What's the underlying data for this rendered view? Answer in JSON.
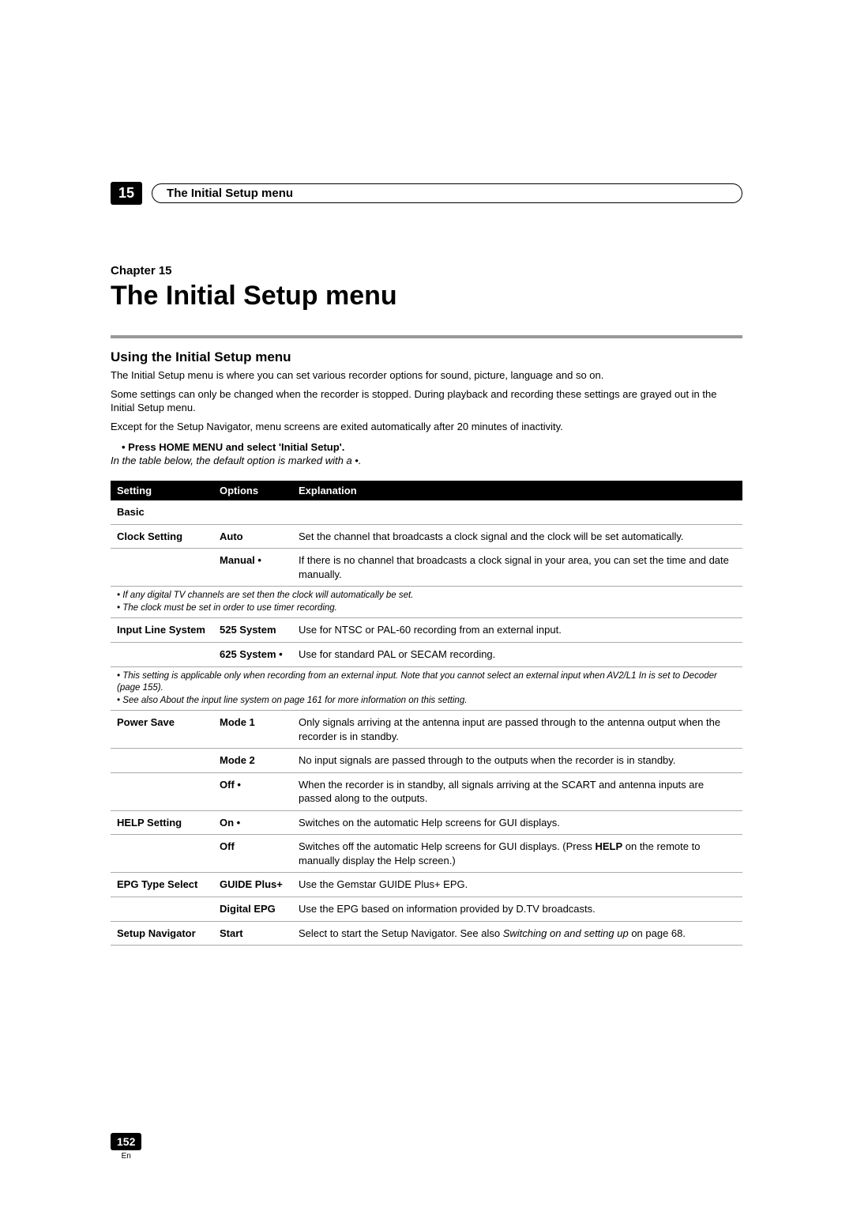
{
  "header": {
    "chapter_num": "15",
    "pill_title": "The Initial Setup menu"
  },
  "chapter": {
    "label": "Chapter 15",
    "title": "The Initial Setup menu"
  },
  "section": {
    "title": "Using the Initial Setup menu",
    "para1": "The Initial Setup menu is where you can set various recorder options for sound, picture, language and so on.",
    "para2": "Some settings can only be changed when the recorder is stopped. During playback and recording these settings are grayed out in the Initial Setup menu.",
    "para3": "Except for the Setup Navigator, menu screens are exited automatically after 20 minutes of inactivity.",
    "bullet": "•   Press HOME MENU and select 'Initial Setup'.",
    "italic_note": "In the table below, the default option is marked with a •."
  },
  "table": {
    "head": {
      "c1": "Setting",
      "c2": "Options",
      "c3": "Explanation"
    },
    "basic_label": "Basic",
    "rows": {
      "clock_auto": {
        "setting": "Clock Setting",
        "option": "Auto",
        "expl": "Set the channel that broadcasts a clock signal and the clock will be set automatically."
      },
      "clock_manual": {
        "option": "Manual •",
        "expl": "If there is no channel that broadcasts a clock signal in your area, you can set the time and date manually."
      },
      "note1a": "• If any digital TV channels are set then the clock will automatically be set.",
      "note1b": "• The clock must be set in order to use timer recording.",
      "ils_525": {
        "setting": "Input Line System",
        "option": "525 System",
        "expl": "Use for NTSC or PAL-60 recording from an external input."
      },
      "ils_625": {
        "option": "625 System •",
        "expl": "Use for standard PAL or SECAM recording."
      },
      "note2a": "• This setting is applicable only when recording from an external input. Note that you cannot select an external input when AV2/L1 In is set to Decoder (page 155).",
      "note2b": "• See also About the input line system on page 161 for more information on this setting.",
      "ps_mode1": {
        "setting": "Power Save",
        "option": "Mode 1",
        "expl": "Only signals arriving at the antenna input are passed through to the antenna output when the recorder is in standby."
      },
      "ps_mode2": {
        "option": "Mode 2",
        "expl": "No input signals are passed through to the outputs when the recorder is in standby."
      },
      "ps_off": {
        "option": "Off •",
        "expl": "When the recorder is in standby, all signals arriving at the SCART and antenna inputs are passed along to the outputs."
      },
      "help_on": {
        "setting": "HELP Setting",
        "option": "On •",
        "expl": "Switches on the automatic Help screens for GUI displays."
      },
      "help_off_pre": "Switches off the automatic Help screens for GUI displays. (Press ",
      "help_off_bold": "HELP",
      "help_off_post": " on the remote to manually display the Help screen.)",
      "help_off_option": "Off",
      "epg_gp": {
        "setting": "EPG Type Select",
        "option": "GUIDE Plus+",
        "expl": "Use the Gemstar GUIDE Plus+ EPG."
      },
      "epg_d": {
        "option": "Digital EPG",
        "expl": "Use the EPG based on information provided by D.TV broadcasts."
      },
      "nav_start_setting": "Setup Navigator",
      "nav_start_option": "Start",
      "nav_start_pre": "Select to start the Setup Navigator. See also ",
      "nav_start_ital": "Switching on and setting up",
      "nav_start_post": " on page 68."
    }
  },
  "footer": {
    "page": "152",
    "lang": "En"
  }
}
